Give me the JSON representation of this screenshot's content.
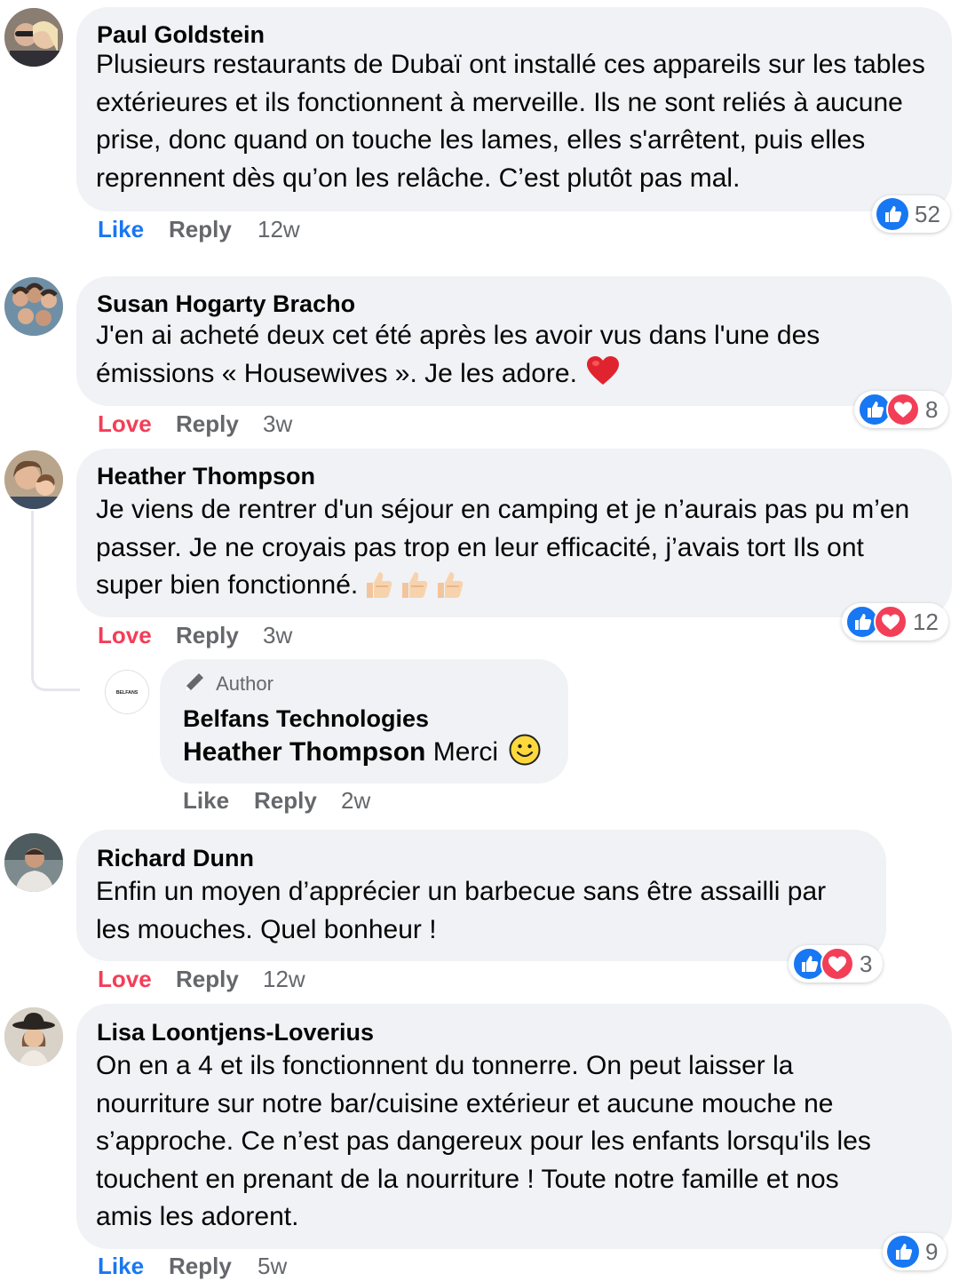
{
  "comments": [
    {
      "author": "Paul Goldstein",
      "lines": [
        "Plusieurs restaurants de Dubaï ont installé ces appareils sur les tables",
        "extérieures et ils fonctionnent à merveille. Ils ne sont reliés à aucune",
        "prise, donc quand on touche les lames, elles s'arrêtent, puis elles",
        "reprennent dès qu’on les relâche. C’est plutôt pas mal."
      ],
      "reaction_label": "Like",
      "reply_label": "Reply",
      "time": "12w",
      "reaction_count": "52"
    },
    {
      "author": "Susan Hogarty Bracho",
      "lines": [
        "J'en ai acheté deux cet été après les avoir vus dans l'une des",
        "émissions « Housewives ». Je les adore."
      ],
      "reaction_label": "Love",
      "reply_label": "Reply",
      "time": "3w",
      "reaction_count": "8"
    },
    {
      "author": "Heather Thompson",
      "lines": [
        "Je viens de rentrer d'un séjour en camping et je n’aurais pas pu m’en",
        "passer. Je ne croyais pas trop en leur efficacité, j’avais tort Ils ont",
        "super bien fonctionné."
      ],
      "reaction_label": "Love",
      "reply_label": "Reply",
      "time": "3w",
      "reaction_count": "12"
    },
    {
      "author": "Richard Dunn",
      "lines": [
        "Enfin un moyen d’apprécier  un barbecue sans être assailli par",
        "les mouches. Quel bonheur !"
      ],
      "reaction_label": "Love",
      "reply_label": "Reply",
      "time": "12w",
      "reaction_count": "3"
    },
    {
      "author": "Lisa Loontjens-Loverius",
      "lines": [
        "On en a 4 et ils fonctionnent du tonnerre. On peut laisser la",
        "nourriture sur notre bar/cuisine extérieur et aucune mouche ne",
        "s’approche. Ce n’est pas dangereux pour les enfants lorsqu'ils les",
        "touchent en prenant de la nourriture ! Toute notre famille et nos",
        "amis les adorent."
      ],
      "reaction_label": "Like",
      "reply_label": "Reply",
      "time": "5w",
      "reaction_count": "9"
    }
  ],
  "reply": {
    "badge": "Author",
    "author": "Belfans Technologies",
    "mention": "Heather Thompson",
    "text": "Merci",
    "avatar_text": "BELFANS",
    "reaction_label": "Like",
    "reply_label": "Reply",
    "time": "2w"
  },
  "colors": {
    "like_blue": "#1877f2",
    "love_red": "#f33e58",
    "bubble_bg": "#f0f2f5",
    "meta_gray": "#65676b"
  },
  "icons": [
    "like-icon",
    "love-icon",
    "heart-emoji",
    "thumbs-up-emoji",
    "smile-emoji",
    "pencil-icon"
  ]
}
